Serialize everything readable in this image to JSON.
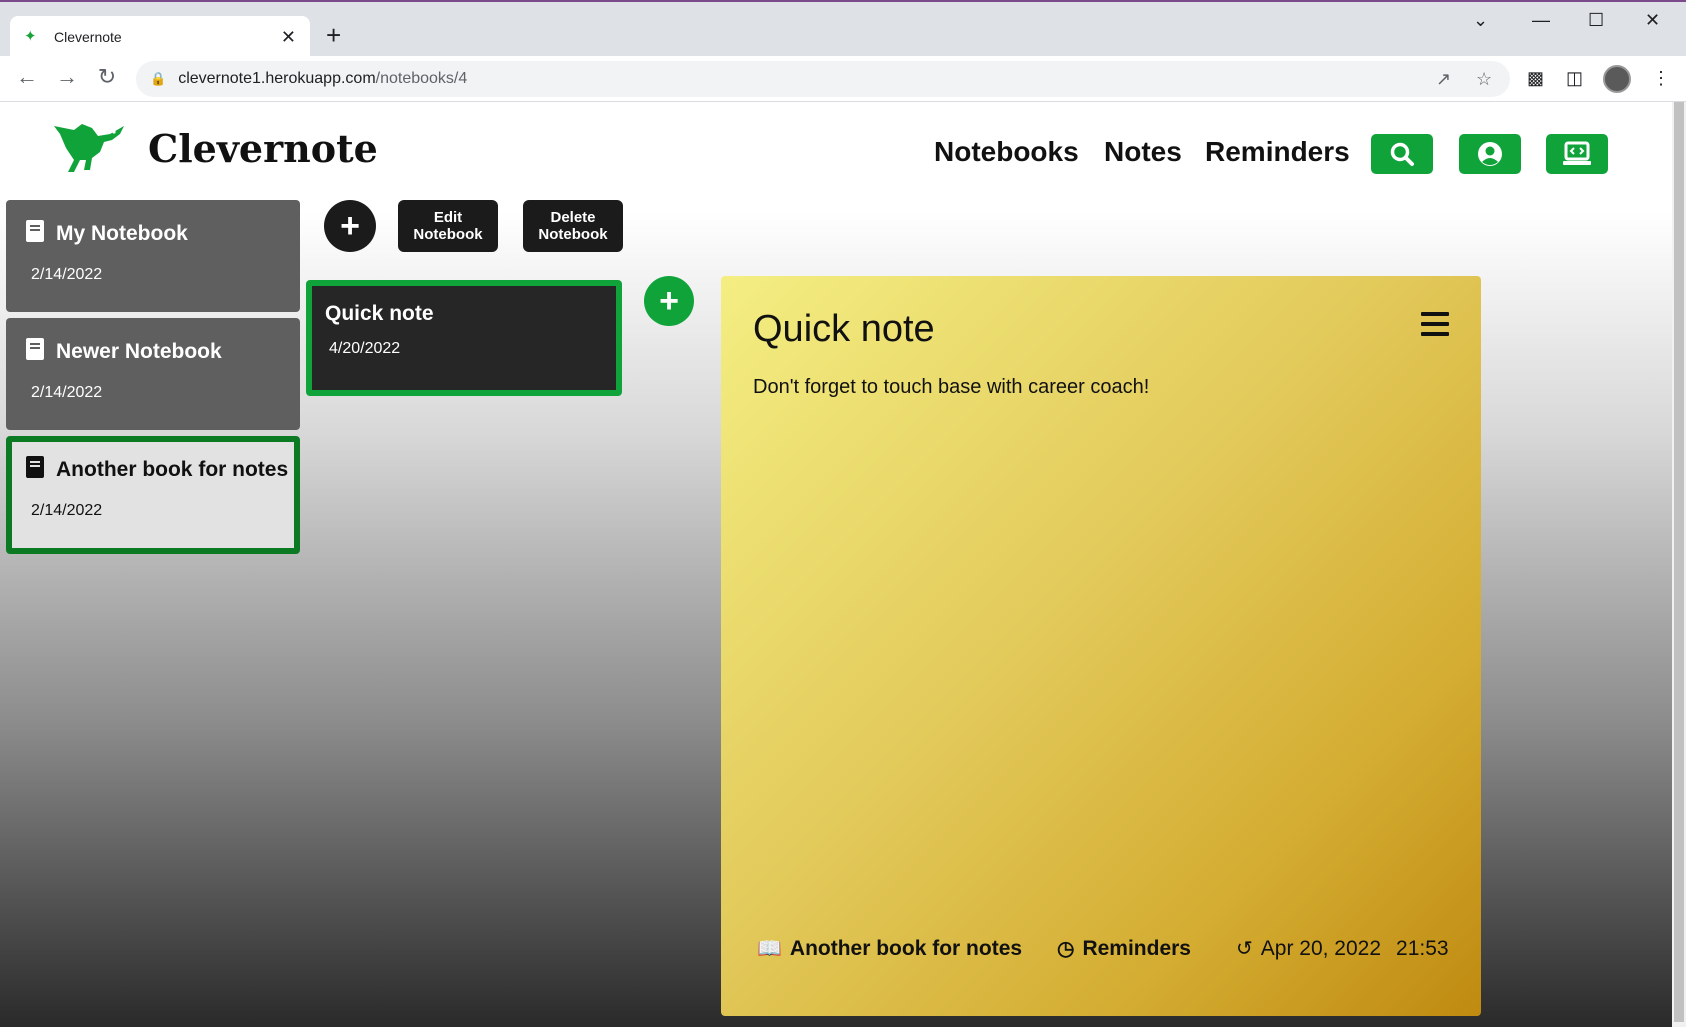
{
  "browser": {
    "tab_title": "Clevernote",
    "url_host": "clevernote1.herokuapp.com",
    "url_path": "/notebooks/4"
  },
  "header": {
    "brand": "Clevernote",
    "nav": {
      "notebooks": "Notebooks",
      "notes": "Notes",
      "reminders": "Reminders"
    }
  },
  "sidebar": {
    "notebooks": [
      {
        "title": "My Notebook",
        "date": "2/14/2022"
      },
      {
        "title": "Newer Notebook",
        "date": "2/14/2022"
      },
      {
        "title": "Another book for notes",
        "date": "2/14/2022"
      }
    ]
  },
  "actions": {
    "edit_notebook": "Edit Notebook",
    "delete_notebook": "Delete Notebook"
  },
  "notes_list": [
    {
      "title": "Quick note",
      "date": "4/20/2022"
    }
  ],
  "note": {
    "title": "Quick note",
    "body": "Don't forget to touch base with career coach!",
    "notebook": "Another book for notes",
    "reminders": "Reminders",
    "date": "Apr 20, 2022",
    "time": "21:53"
  },
  "colors": {
    "accent_green": "#10a33a",
    "active_border": "#0c7a22",
    "note_yellow": "#e2c95a"
  }
}
